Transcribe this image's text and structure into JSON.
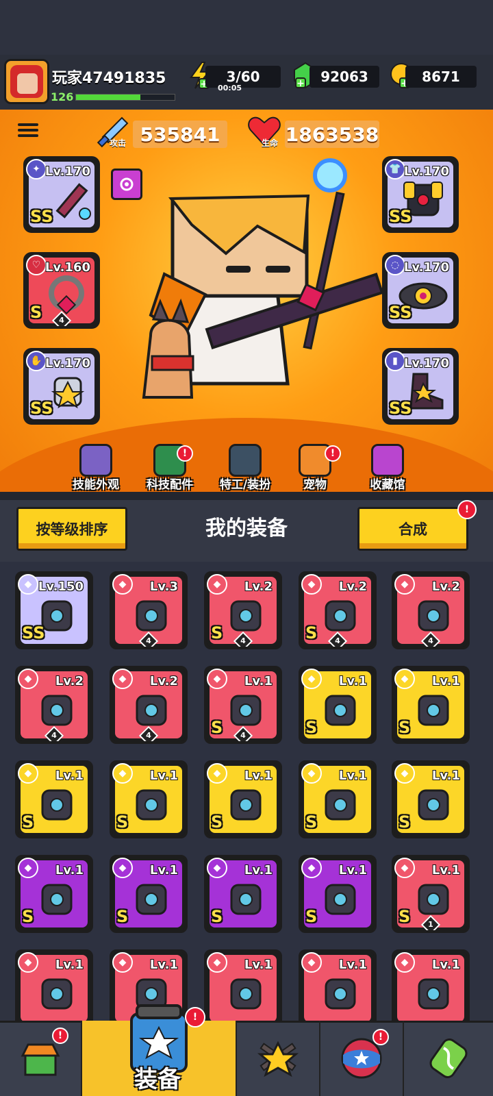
{
  "player": {
    "name": "玩家47491835",
    "level": "126",
    "xp_fraction": 0.65
  },
  "resources": {
    "energy": {
      "value": "3/60",
      "timer": "00:05"
    },
    "gems": {
      "value": "92063"
    },
    "gold": {
      "value": "8671"
    }
  },
  "stats": {
    "attack": {
      "label": "攻击",
      "value": "535841"
    },
    "hp": {
      "label": "生命",
      "value": "1863538"
    }
  },
  "equipped": {
    "left": [
      {
        "level": "Lv.170",
        "rank": "SS",
        "icon": "weapon-icon",
        "color": "#b8b0ef"
      },
      {
        "level": "Lv.160",
        "rank": "S",
        "icon": "necklace-icon",
        "count": "4",
        "color": "#ee4a59"
      },
      {
        "level": "Lv.170",
        "rank": "SS",
        "icon": "glove-icon",
        "color": "#b8b0ef"
      }
    ],
    "right": [
      {
        "level": "Lv.170",
        "rank": "SS",
        "icon": "armor-icon",
        "color": "#b8b0ef"
      },
      {
        "level": "Lv.170",
        "rank": "SS",
        "icon": "belt-icon",
        "color": "#b8b0ef"
      },
      {
        "level": "Lv.170",
        "rank": "SS",
        "icon": "boots-icon",
        "color": "#b8b0ef"
      }
    ]
  },
  "character_nav": [
    {
      "label": "技能外观",
      "icon": "skill-skin-icon",
      "alert": false
    },
    {
      "label": "科技配件",
      "icon": "tech-part-icon",
      "alert": true
    },
    {
      "label": "特工/装扮",
      "icon": "agent-costume-icon",
      "alert": false
    },
    {
      "label": "宠物",
      "icon": "pet-icon",
      "alert": true
    },
    {
      "label": "收藏馆",
      "icon": "collection-icon",
      "alert": false
    }
  ],
  "equipment_panel": {
    "title": "我的装备",
    "sort_button": "按等级排序",
    "merge_button": "合成"
  },
  "inventory": [
    {
      "level": "Lv.150",
      "rank": "SS",
      "color": "#c9c2ff",
      "count": ""
    },
    {
      "level": "Lv.3",
      "rank": "",
      "color": "#f0566b",
      "count": "4"
    },
    {
      "level": "Lv.2",
      "rank": "S",
      "color": "#f0566b",
      "count": "4"
    },
    {
      "level": "Lv.2",
      "rank": "S",
      "color": "#f0566b",
      "count": "4"
    },
    {
      "level": "Lv.2",
      "rank": "",
      "color": "#f0566b",
      "count": "4"
    },
    {
      "level": "Lv.2",
      "rank": "",
      "color": "#f0566b",
      "count": "4"
    },
    {
      "level": "Lv.2",
      "rank": "",
      "color": "#f0566b",
      "count": "4"
    },
    {
      "level": "Lv.1",
      "rank": "S",
      "color": "#f0566b",
      "count": "4"
    },
    {
      "level": "Lv.1",
      "rank": "S",
      "color": "#fcd628",
      "count": ""
    },
    {
      "level": "Lv.1",
      "rank": "S",
      "color": "#fcd628",
      "count": ""
    },
    {
      "level": "Lv.1",
      "rank": "S",
      "color": "#fcd628",
      "count": ""
    },
    {
      "level": "Lv.1",
      "rank": "S",
      "color": "#fcd628",
      "count": ""
    },
    {
      "level": "Lv.1",
      "rank": "S",
      "color": "#fcd628",
      "count": ""
    },
    {
      "level": "Lv.1",
      "rank": "S",
      "color": "#fcd628",
      "count": ""
    },
    {
      "level": "Lv.1",
      "rank": "S",
      "color": "#fcd628",
      "count": ""
    },
    {
      "level": "Lv.1",
      "rank": "S",
      "color": "#a532d7",
      "count": ""
    },
    {
      "level": "Lv.1",
      "rank": "S",
      "color": "#a532d7",
      "count": ""
    },
    {
      "level": "Lv.1",
      "rank": "S",
      "color": "#a532d7",
      "count": ""
    },
    {
      "level": "Lv.1",
      "rank": "S",
      "color": "#a532d7",
      "count": ""
    },
    {
      "level": "Lv.1",
      "rank": "S",
      "color": "#f0566b",
      "count": "1"
    },
    {
      "level": "Lv.1",
      "rank": "",
      "color": "#f0566b",
      "count": ""
    },
    {
      "level": "Lv.1",
      "rank": "",
      "color": "#f0566b",
      "count": ""
    },
    {
      "level": "Lv.1",
      "rank": "",
      "color": "#f0566b",
      "count": ""
    },
    {
      "level": "Lv.1",
      "rank": "",
      "color": "#f0566b",
      "count": ""
    },
    {
      "level": "Lv.1",
      "rank": "",
      "color": "#f0566b",
      "count": ""
    }
  ],
  "bottom_nav": {
    "shop": {
      "icon": "shop-icon",
      "alert": true
    },
    "equipment": {
      "label": "装备",
      "icon": "equipment-icon",
      "alert": true
    },
    "battle": {
      "icon": "battle-icon"
    },
    "ball": {
      "icon": "orb-icon",
      "alert": true
    },
    "lab": {
      "icon": "dna-icon"
    }
  },
  "colors": {
    "orange": "#ff9d14",
    "yellow": "#fcd628",
    "red": "#f0566b",
    "purple": "#a532d7",
    "lavender": "#b8b0ef",
    "alert": "#ea1b35"
  }
}
